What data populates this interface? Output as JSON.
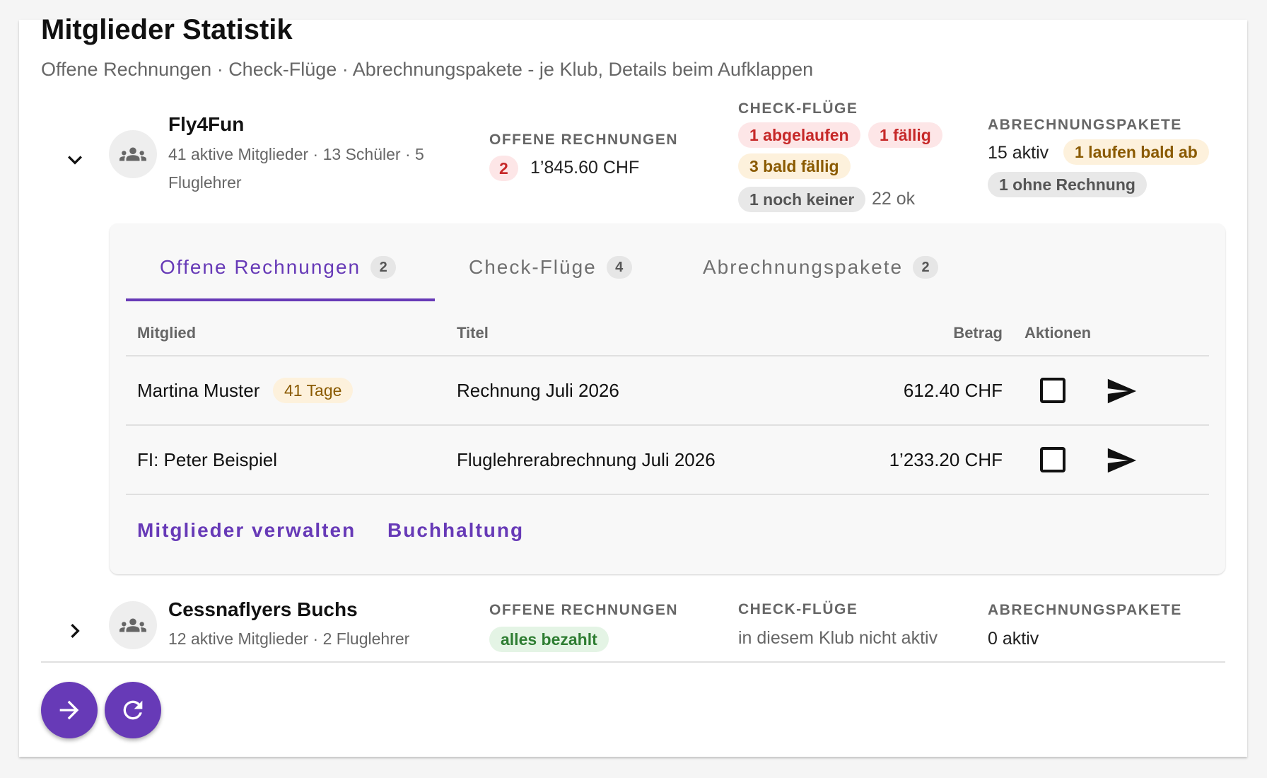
{
  "page": {
    "title": "Mitglieder Statistik",
    "subtitle": "Offene Rechnungen · Check-Flüge · Abrechnungspakete - je Klub, Details beim Aufklappen"
  },
  "accent_color": "#673ab7",
  "clubs": [
    {
      "name": "Fly4Fun",
      "meta_line1": "41 aktive Mitglieder · 13 Schüler · 5",
      "meta_line2": "Fluglehrer",
      "expanded": true,
      "invoices": {
        "label": "OFFENE RECHNUNGEN",
        "count": "2",
        "amount": "1’845.60 CHF"
      },
      "checks": {
        "label": "CHECK-FLÜGE",
        "expired": "1 abgelaufen",
        "due": "1 fällig",
        "due_soon": "3 bald fällig",
        "none_yet": "1 noch keiner",
        "ok": "22 ok"
      },
      "packages": {
        "label": "ABRECHNUNGSPAKETE",
        "active": "15 aktiv",
        "expiring": "1 laufen bald ab",
        "no_invoice": "1 ohne Rechnung"
      }
    },
    {
      "name": "Cessnaflyers Buchs",
      "meta_line1": "12 aktive Mitglieder · 2 Fluglehrer",
      "expanded": false,
      "invoices": {
        "label": "OFFENE RECHNUNGEN",
        "status": "alles bezahlt"
      },
      "checks": {
        "label": "CHECK-FLÜGE",
        "status": "in diesem Klub nicht aktiv"
      },
      "packages": {
        "label": "ABRECHNUNGSPAKETE",
        "active": "0 aktiv"
      }
    }
  ],
  "tabs": [
    {
      "label": "Offene Rechnungen",
      "count": "2",
      "active": true
    },
    {
      "label": "Check-Flüge",
      "count": "4",
      "active": false
    },
    {
      "label": "Abrechnungspakete",
      "count": "2",
      "active": false
    }
  ],
  "table": {
    "headers": {
      "member": "Mitglied",
      "title": "Titel",
      "amount": "Betrag",
      "actions": "Aktionen"
    },
    "rows": [
      {
        "member": "Martina Muster",
        "badge": "41 Tage",
        "title": "Rechnung Juli 2026",
        "amount": "612.40 CHF"
      },
      {
        "member": "FI: Peter Beispiel",
        "title": "Fluglehrerabrechnung Juli 2026",
        "amount": "1’233.20 CHF"
      }
    ]
  },
  "links": {
    "manage": "Mitglieder verwalten",
    "accounting": "Buchhaltung"
  },
  "icons": {
    "chevron_expanded": "chevron-down-icon",
    "chevron_collapsed": "chevron-right-icon",
    "club": "group-icon",
    "send": "send-icon",
    "fab_forward": "arrow-forward-icon",
    "fab_refresh": "refresh-icon"
  }
}
